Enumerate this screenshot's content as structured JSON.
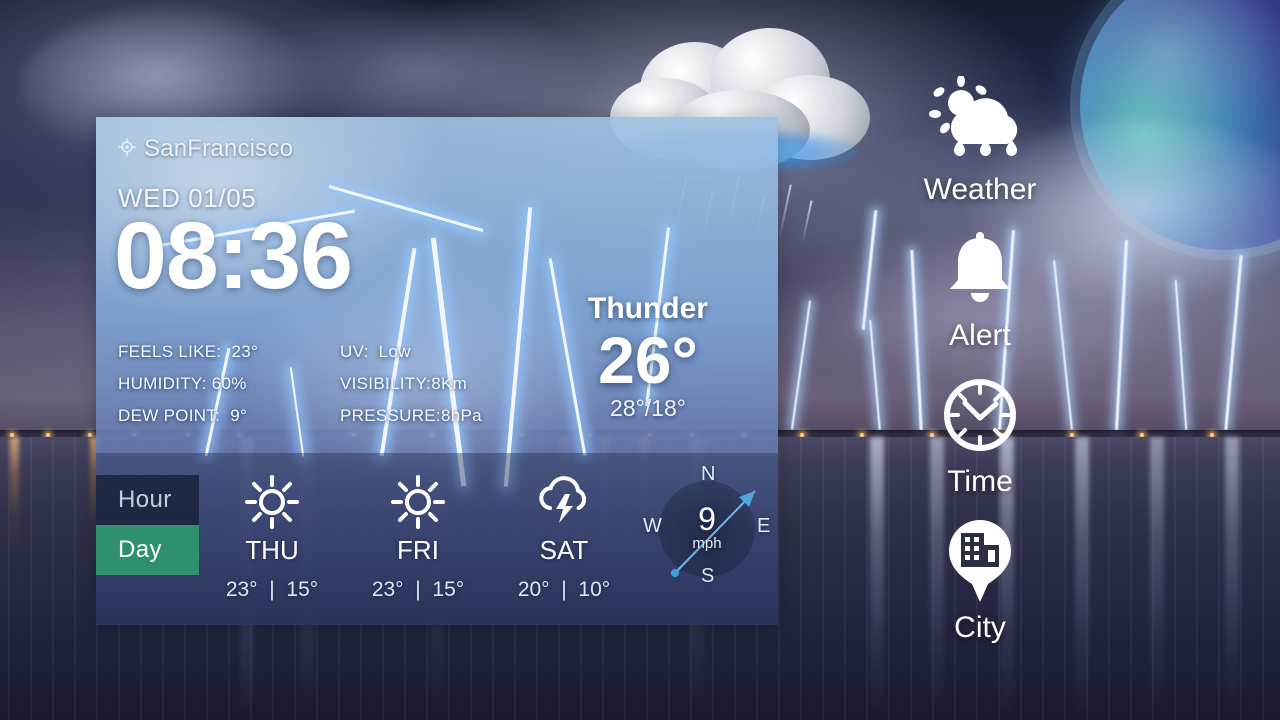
{
  "background": {
    "scene_description": "night thunderstorm over a lake with lightning, clouds and a planet"
  },
  "widget": {
    "location": {
      "icon": "gps-crosshair-icon",
      "name": "SanFrancisco"
    },
    "date": "WED 01/05",
    "time": "08:36",
    "details": [
      {
        "left_label": "FEELS LIKE:",
        "left_value": "23°",
        "right_label": "UV:",
        "right_value": "Low"
      },
      {
        "left_label": "HUMIDITY:",
        "left_value": "60%",
        "right_label": "VISIBILITY:",
        "right_value": "8Km"
      },
      {
        "left_label": "DEW POINT:",
        "left_value": "9°",
        "right_label": "PRESSURE:",
        "right_value": "8hPa"
      }
    ],
    "current": {
      "condition": "Thunder",
      "temperature": "26°",
      "range": "28°/18°"
    },
    "forecast_tabs": [
      {
        "label": "Hour",
        "active": false
      },
      {
        "label": "Day",
        "active": true
      }
    ],
    "forecast": [
      {
        "day": "THU",
        "icon": "sun-icon",
        "high": "23°",
        "sep": "|",
        "low": "15°"
      },
      {
        "day": "FRI",
        "icon": "sun-icon",
        "high": "23°",
        "sep": "|",
        "low": "15°"
      },
      {
        "day": "SAT",
        "icon": "thunderstorm-cloud-icon",
        "high": "20°",
        "sep": "|",
        "low": "10°"
      }
    ],
    "wind": {
      "speed": "9",
      "unit": "mph",
      "north": "N",
      "east": "E",
      "south": "S",
      "west": "W",
      "direction_arrow": "southwest-to-northeast"
    }
  },
  "launcher": {
    "items": [
      {
        "label": "Weather",
        "icon": "sun-cloud-rain-icon"
      },
      {
        "label": "Alert",
        "icon": "bell-icon"
      },
      {
        "label": "Time",
        "icon": "clock-icon"
      },
      {
        "label": "City",
        "icon": "city-pin-icon"
      }
    ]
  },
  "colors": {
    "active_tab": "#2f9070",
    "inactive_tab": "#121c30",
    "text": "#ffffff",
    "accent_wind_arrow": "#5aa9e8"
  }
}
